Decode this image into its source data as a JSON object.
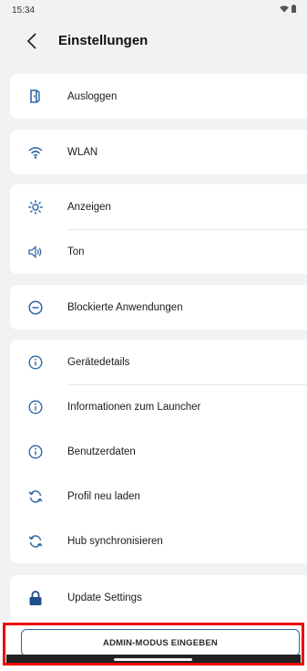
{
  "status_bar": {
    "time": "15:34",
    "icons": [
      "wifi-icon",
      "battery-icon"
    ]
  },
  "header": {
    "back_icon": "chevron-left-icon",
    "title": "Einstellungen"
  },
  "sections": [
    {
      "items": [
        {
          "label": "Ausloggen",
          "icon": "logout-icon"
        }
      ]
    },
    {
      "items": [
        {
          "label": "WLAN",
          "icon": "wifi-icon"
        }
      ]
    },
    {
      "items": [
        {
          "label": "Anzeigen",
          "icon": "brightness-icon"
        },
        {
          "label": "Ton",
          "icon": "speaker-icon"
        }
      ]
    },
    {
      "items": [
        {
          "label": "Blockierte Anwendungen",
          "icon": "block-icon"
        }
      ]
    },
    {
      "items": [
        {
          "label": "Gerätedetails",
          "icon": "info-icon"
        },
        {
          "label": "Informationen zum Launcher",
          "icon": "info-icon"
        },
        {
          "label": "Benutzerdaten",
          "icon": "info-icon"
        },
        {
          "label": "Profil neu laden",
          "icon": "sync-icon"
        },
        {
          "label": "Hub synchronisieren",
          "icon": "sync-icon"
        }
      ]
    },
    {
      "items": [
        {
          "label": "Update Settings",
          "icon": "lock-icon"
        }
      ]
    }
  ],
  "admin_button": {
    "label": "ADMIN-MODUS EINGEBEN"
  },
  "colors": {
    "accent": "#2f66a8",
    "highlight": "#ef0000",
    "background": "#f2f2f5",
    "card": "#ffffff"
  }
}
